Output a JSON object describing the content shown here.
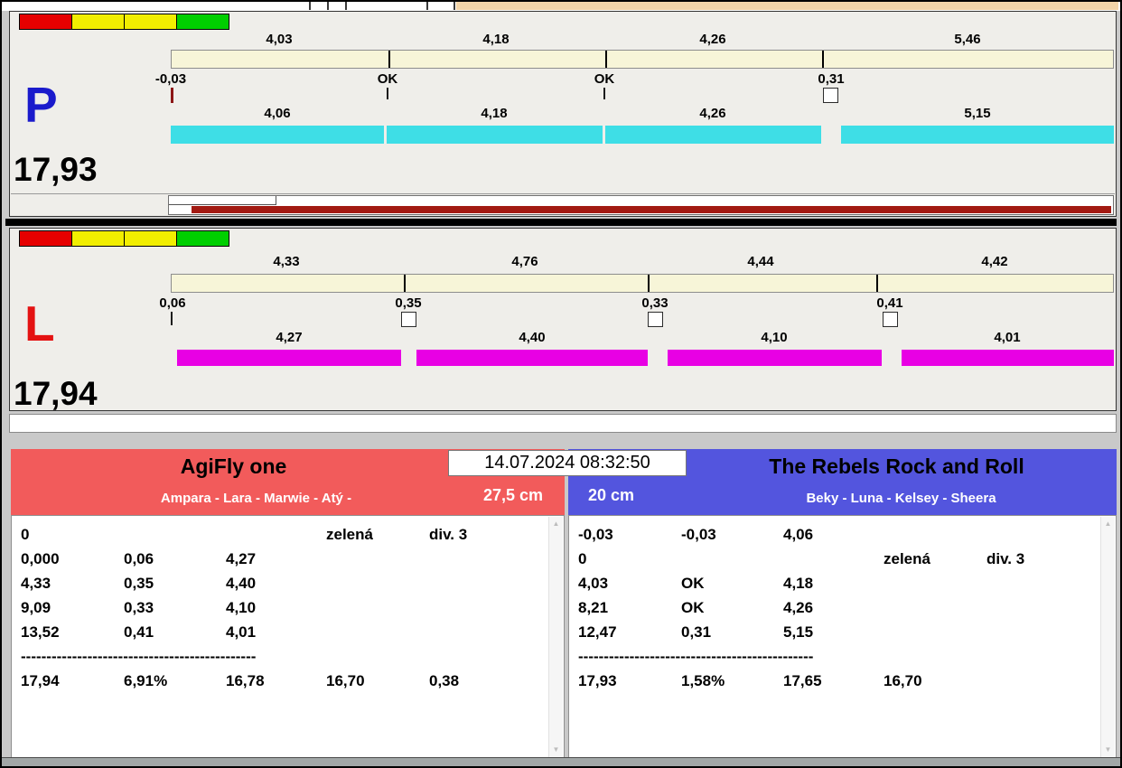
{
  "datetime": "14.07.2024 08:32:50",
  "lanes": {
    "p": {
      "letter": "P",
      "total": "17,93",
      "top_values": [
        "4,03",
        "4,18",
        "4,26",
        "5,46"
      ],
      "mid_labels": [
        "-0,03",
        "OK",
        "OK",
        "0,31"
      ],
      "bottom_values": [
        "4,06",
        "4,18",
        "4,26",
        "5,15"
      ]
    },
    "l": {
      "letter": "L",
      "total": "17,94",
      "top_values": [
        "4,33",
        "4,76",
        "4,44",
        "4,42"
      ],
      "mid_labels": [
        "0,06",
        "0,35",
        "0,33",
        "0,41"
      ],
      "bottom_values": [
        "4,27",
        "4,40",
        "4,10",
        "4,01"
      ]
    }
  },
  "teams": {
    "left": {
      "name": "AgiFly one",
      "members": "Ampara - Lara - Marwie - Atý -",
      "jump_height": "27,5 cm",
      "rows": [
        [
          "0",
          "",
          "",
          "zelená",
          "div. 3"
        ],
        [
          "0,000",
          "0,06",
          "4,27",
          "",
          ""
        ],
        [
          "4,33",
          "0,35",
          "4,40",
          "",
          ""
        ],
        [
          "9,09",
          "0,33",
          "4,10",
          "",
          ""
        ],
        [
          "13,52",
          "0,41",
          "4,01",
          "",
          ""
        ]
      ],
      "divider": "----------------------------------------------",
      "summary": [
        "17,94",
        "6,91%",
        "16,78",
        "16,70",
        "0,38"
      ]
    },
    "right": {
      "name": "The Rebels Rock and Roll",
      "members": "Beky - Luna - Kelsey - Sheera",
      "jump_height": "20 cm",
      "rows": [
        [
          "-0,03",
          "-0,03",
          "4,06",
          "",
          ""
        ],
        [
          "0",
          "",
          "",
          "zelená",
          "div. 3"
        ],
        [
          "4,03",
          "OK",
          "4,18",
          "",
          ""
        ],
        [
          "8,21",
          "OK",
          "4,26",
          "",
          ""
        ],
        [
          "12,47",
          "0,31",
          "5,15",
          "",
          ""
        ]
      ],
      "divider": "----------------------------------------------",
      "summary": [
        "17,93",
        "1,58%",
        "17,65",
        "16,70",
        ""
      ]
    }
  },
  "colors": {
    "indicator": [
      "#e60000",
      "#f2ee00",
      "#f2ee00",
      "#00cf00"
    ],
    "p_letter": "#1a1acc",
    "l_letter": "#e41212",
    "p_bar": "#3edee6",
    "l_bar": "#e800e4",
    "cream_bar": "#f7f5d8",
    "progress_fill": "#a21a12",
    "left_header": "#f25b5b",
    "right_header": "#5355de"
  },
  "scrollbar": {
    "up": "▲",
    "down": "▼"
  }
}
